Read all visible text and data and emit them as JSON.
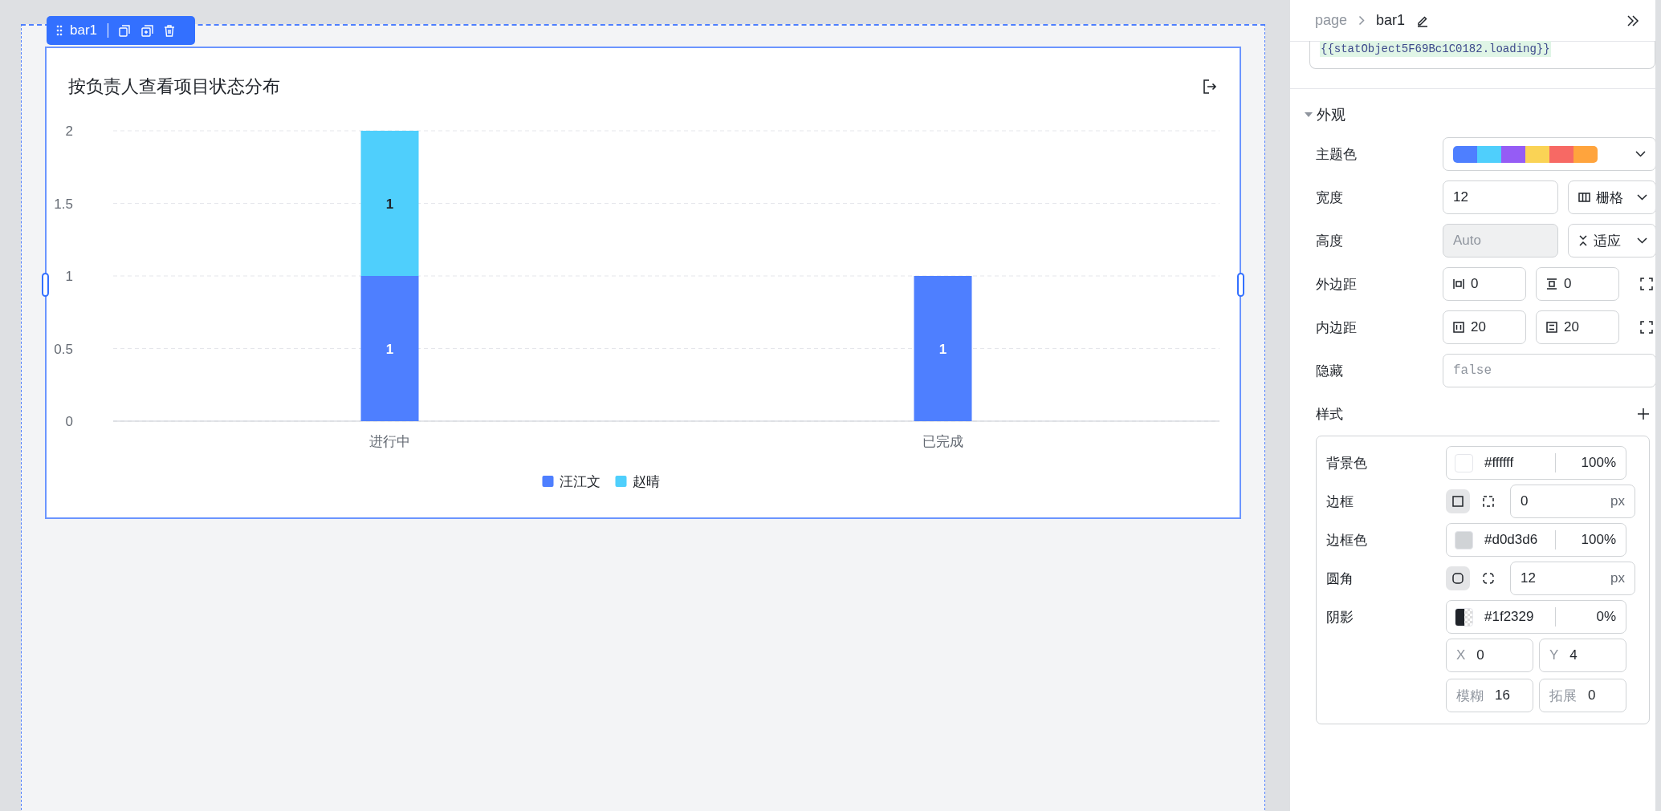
{
  "canvas": {
    "component": {
      "name": "bar1"
    },
    "chart": {
      "title": "按负责人查看项目状态分布",
      "chart_data": {
        "type": "bar",
        "stacked": true,
        "categories": [
          "进行中",
          "已完成"
        ],
        "series": [
          {
            "name": "汪江文",
            "color": "#4e7fff",
            "values": [
              1,
              1
            ]
          },
          {
            "name": "赵晴",
            "color": "#4fcffc",
            "values": [
              1,
              null
            ]
          }
        ],
        "ylim": [
          0,
          2
        ],
        "yticks": [
          0,
          0.5,
          1,
          1.5,
          2
        ],
        "data_labels": true,
        "grid": true,
        "legend": "bottom"
      }
    }
  },
  "panel": {
    "breadcrumb": [
      {
        "label": "page",
        "selected": false
      },
      {
        "label": "bar1",
        "selected": true
      }
    ],
    "code_field": {
      "value": "{{statObject5F69Bc1C0182.loading}}"
    },
    "appearance": {
      "title": "外观",
      "expanded": true,
      "rows": [
        {
          "kind": "palette",
          "label": "主题色",
          "colors": [
            {
              "color": "#4e7fff"
            },
            {
              "color": "#4fcffc"
            },
            {
              "color": "#955cf5"
            },
            {
              "color": "#fad355"
            },
            {
              "color": "#f76964"
            },
            {
              "color": "#ffa43d"
            }
          ]
        },
        {
          "kind": "grid_width",
          "label": "宽度",
          "value": "12",
          "option": "栅格"
        },
        {
          "kind": "fit_height",
          "label": "高度",
          "placeholder": "Auto",
          "disabled": true,
          "option": "适应"
        },
        {
          "kind": "margin",
          "label": "外边距",
          "values": [
            "0",
            "0"
          ]
        },
        {
          "kind": "padding",
          "label": "内边距",
          "values": [
            "20",
            "20"
          ]
        },
        {
          "kind": "code",
          "label": "隐藏",
          "placeholder": "false"
        }
      ]
    },
    "style": {
      "title": "样式",
      "rows": [
        {
          "kind": "color",
          "label": "背景色",
          "color": "#ffffff",
          "value": "#ffffff",
          "opacity": "100%"
        },
        {
          "kind": "border",
          "label": "边框",
          "modes": [
            {
              "selected": true
            },
            {
              "selected": false
            }
          ],
          "value": "0",
          "unit": "px"
        },
        {
          "kind": "color",
          "label": "边框色",
          "color": "#d0d3d6",
          "value": "#d0d3d6",
          "opacity": "100%"
        },
        {
          "kind": "radius",
          "label": "圆角",
          "modes": [
            {
              "selected": true
            },
            {
              "selected": false
            }
          ],
          "value": "12",
          "unit": "px"
        },
        {
          "kind": "shadow",
          "label": "阴影",
          "color": "#1f2329",
          "value": "#1f2329",
          "opacity": "0%",
          "fields": [
            {
              "label": "X",
              "value": "0"
            },
            {
              "label": "Y",
              "value": "4"
            },
            {
              "label": "模糊",
              "value": "16"
            },
            {
              "label": "拓展",
              "value": "0"
            }
          ]
        }
      ]
    }
  }
}
